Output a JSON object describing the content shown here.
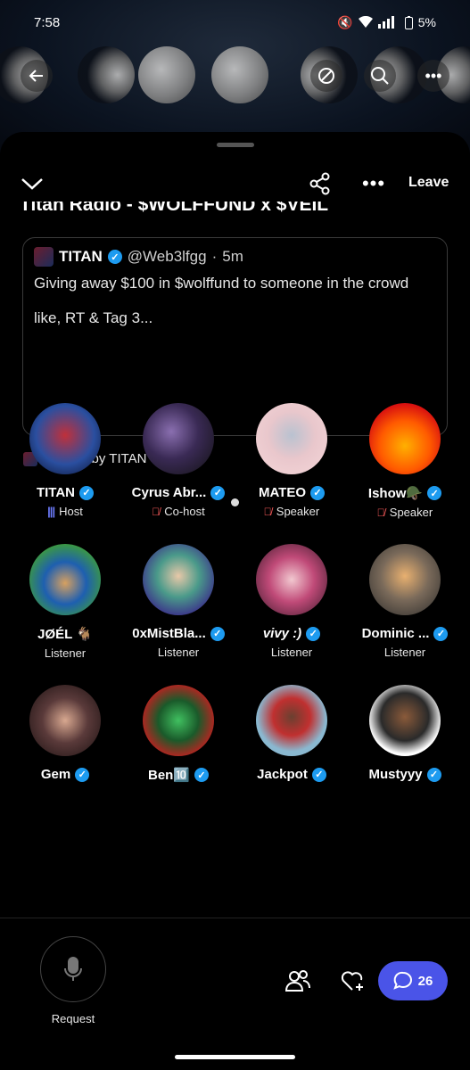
{
  "status_bar": {
    "time": "7:58",
    "battery": "5%"
  },
  "header": {
    "leave_label": "Leave"
  },
  "space": {
    "title": "Titan Radio - $WOLFFUND x $VEIL"
  },
  "tweet": {
    "name": "TITAN",
    "handle": "@Web3lfgg",
    "time": "5m",
    "text": "Giving away $100 in $wolffund to someone in the crowd",
    "text2": "like, RT & Tag 3..."
  },
  "shared_by": "Shared by TITAN",
  "participants": [
    {
      "name": "TITAN",
      "role": "Host",
      "role_icon": "host-bars",
      "verified": true
    },
    {
      "name": "Cyrus Abr...",
      "role": "Co-host",
      "role_icon": "mic-off",
      "verified": true
    },
    {
      "name": "MATEO",
      "role": "Speaker",
      "role_icon": "mic-off",
      "verified": true
    },
    {
      "name": "Ishow🪖",
      "role": "Speaker",
      "role_icon": "mic-off",
      "verified": true
    },
    {
      "name": "JØÉL 🐐",
      "role": "Listener",
      "role_icon": "",
      "verified": false
    },
    {
      "name": "0xMistBla...",
      "role": "Listener",
      "role_icon": "",
      "verified": true
    },
    {
      "name": "vivy :)",
      "role": "Listener",
      "role_icon": "",
      "verified": true
    },
    {
      "name": "Dominic ...",
      "role": "Listener",
      "role_icon": "",
      "verified": true
    },
    {
      "name": "Gem",
      "role": "",
      "role_icon": "",
      "verified": true
    },
    {
      "name": "Ben🔟",
      "role": "",
      "role_icon": "",
      "verified": true
    },
    {
      "name": "Jackpot",
      "role": "",
      "role_icon": "",
      "verified": true
    },
    {
      "name": "Mustyyy",
      "role": "",
      "role_icon": "",
      "verified": true
    }
  ],
  "bottom": {
    "request_label": "Request",
    "chat_count": "26"
  },
  "colors": {
    "accent": "#4a54e8",
    "verified": "#1d9bf0",
    "host": "#6e7dff",
    "mic_off": "#ff5d5d"
  }
}
